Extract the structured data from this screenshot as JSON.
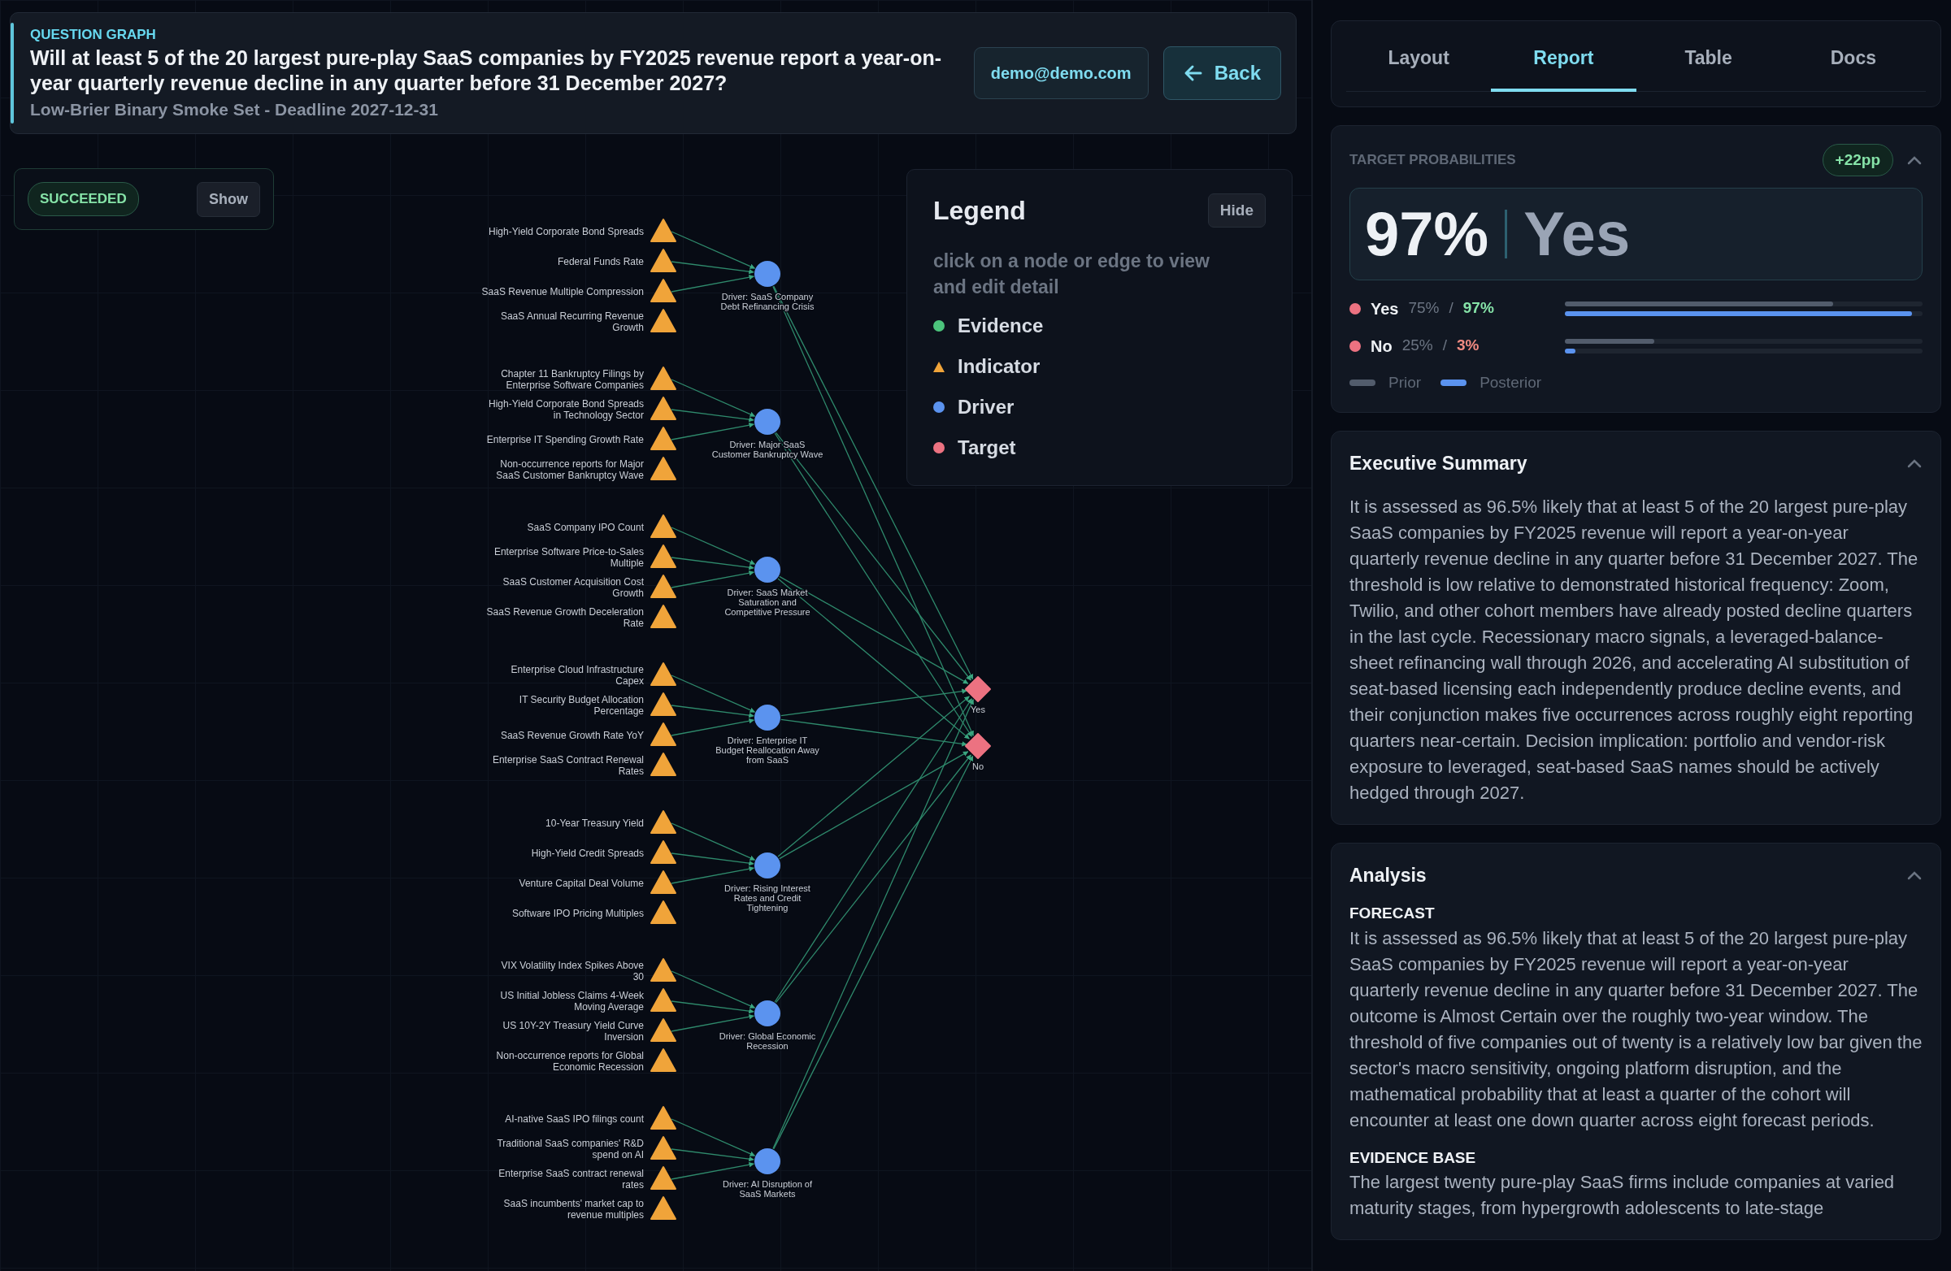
{
  "header": {
    "eyebrow": "QUESTION GRAPH",
    "question": "Will at least 5 of the 20 largest pure-play SaaS companies by FY2025 revenue report a year-on-year quarterly revenue decline in any quarter before 31 December 2027?",
    "subtitle": "Low-Brier Binary Smoke Set - Deadline 2027-12-31",
    "user": "demo@demo.com",
    "back": "Back"
  },
  "status": {
    "badge": "SUCCEEDED",
    "button": "Show"
  },
  "legend": {
    "title": "Legend",
    "button": "Hide",
    "hint": "click on a node or edge to view and edit detail",
    "items": [
      {
        "label": "Evidence",
        "kind": "dot",
        "color": "#4cc47c"
      },
      {
        "label": "Indicator",
        "kind": "triangle",
        "color": "#f0a43a"
      },
      {
        "label": "Driver",
        "kind": "dot",
        "color": "#5b93ef"
      },
      {
        "label": "Target",
        "kind": "dot",
        "color": "#ec7281"
      }
    ]
  },
  "graph": {
    "targets": [
      {
        "label": "Yes"
      },
      {
        "label": "No"
      }
    ],
    "drivers": [
      {
        "label": "Driver: SaaS Company Debt Refinancing Crisis",
        "indicators": [
          {
            "label": "High-Yield Corporate Bond Spreads",
            "linked": true
          },
          {
            "label": "Federal Funds Rate",
            "linked": true
          },
          {
            "label": "SaaS Revenue Multiple Compression",
            "linked": true
          },
          {
            "label": "SaaS Annual Recurring Revenue Growth",
            "linked": false
          }
        ]
      },
      {
        "label": "Driver: Major SaaS Customer Bankruptcy Wave",
        "indicators": [
          {
            "label": "Chapter 11 Bankruptcy Filings by Enterprise Software Companies",
            "linked": true
          },
          {
            "label": "High-Yield Corporate Bond Spreads in Technology Sector",
            "linked": true
          },
          {
            "label": "Enterprise IT Spending Growth Rate",
            "linked": true
          },
          {
            "label": "Non-occurrence reports for Major SaaS Customer Bankruptcy Wave",
            "linked": false
          }
        ]
      },
      {
        "label": "Driver: SaaS Market Saturation and Competitive Pressure",
        "indicators": [
          {
            "label": "SaaS Company IPO Count",
            "linked": true
          },
          {
            "label": "Enterprise Software Price-to-Sales Multiple",
            "linked": true
          },
          {
            "label": "SaaS Customer Acquisition Cost Growth",
            "linked": true
          },
          {
            "label": "SaaS Revenue Growth Deceleration Rate",
            "linked": false
          }
        ]
      },
      {
        "label": "Driver: Enterprise IT Budget Reallocation Away from SaaS",
        "indicators": [
          {
            "label": "Enterprise Cloud Infrastructure Capex",
            "linked": true
          },
          {
            "label": "IT Security Budget Allocation Percentage",
            "linked": true
          },
          {
            "label": "SaaS Revenue Growth Rate YoY",
            "linked": true
          },
          {
            "label": "Enterprise SaaS Contract Renewal Rates",
            "linked": false
          }
        ]
      },
      {
        "label": "Driver: Rising Interest Rates and Credit Tightening",
        "indicators": [
          {
            "label": "10-Year Treasury Yield",
            "linked": true
          },
          {
            "label": "High-Yield Credit Spreads",
            "linked": true
          },
          {
            "label": "Venture Capital Deal Volume",
            "linked": true
          },
          {
            "label": "Software IPO Pricing Multiples",
            "linked": false
          }
        ]
      },
      {
        "label": "Driver: Global Economic Recession",
        "indicators": [
          {
            "label": "VIX Volatility Index Spikes Above 30",
            "linked": true
          },
          {
            "label": "US Initial Jobless Claims 4-Week Moving Average",
            "linked": true
          },
          {
            "label": "US 10Y-2Y Treasury Yield Curve Inversion",
            "linked": true
          },
          {
            "label": "Non-occurrence reports for Global Economic Recession",
            "linked": false
          }
        ]
      },
      {
        "label": "Driver: AI Disruption of SaaS Markets",
        "indicators": [
          {
            "label": "AI-native SaaS IPO filings count",
            "linked": true
          },
          {
            "label": "Traditional SaaS companies' R&D spend on AI",
            "linked": true
          },
          {
            "label": "Enterprise SaaS contract renewal rates",
            "linked": true
          },
          {
            "label": "SaaS incumbents' market cap to revenue multiples",
            "linked": false
          }
        ]
      }
    ]
  },
  "tabs": [
    {
      "label": "Layout",
      "selected": false
    },
    {
      "label": "Report",
      "selected": true
    },
    {
      "label": "Table",
      "selected": false
    },
    {
      "label": "Docs",
      "selected": false
    }
  ],
  "probabilities": {
    "title": "TARGET PROBABILITIES",
    "delta": "+22pp",
    "expanded": true,
    "headline_value": "97%",
    "headline_label": "Yes",
    "outcomes": [
      {
        "label": "Yes",
        "separator": "/",
        "prior": {
          "text": "75%",
          "level": 0.75
        },
        "posterior": {
          "text": "97%",
          "level": 0.97,
          "color": "#86e3a8"
        }
      },
      {
        "label": "No",
        "separator": "/",
        "prior": {
          "text": "25%",
          "level": 0.25
        },
        "posterior": {
          "text": "3%",
          "level": 0.03,
          "color": "#f28b82"
        }
      }
    ],
    "legend": [
      "Prior",
      "Posterior"
    ]
  },
  "summary": {
    "title": "Executive Summary",
    "expanded": true,
    "text": "It is assessed as 96.5% likely that at least 5 of the 20 largest pure-play SaaS companies by FY2025 revenue will report a year-on-year quarterly revenue decline in any quarter before 31 December 2027. The threshold is low relative to demonstrated historical frequency: Zoom, Twilio, and other cohort members have already posted decline quarters in the last cycle. Recessionary macro signals, a leveraged-balance-sheet refinancing wall through 2026, and accelerating AI substitution of seat-based licensing each independently produce decline events, and their conjunction makes five occurrences across roughly eight reporting quarters near-certain. Decision implication: portfolio and vendor-risk exposure to leveraged, seat-based SaaS names should be actively hedged through 2027."
  },
  "analysis": {
    "title": "Analysis",
    "expanded": true,
    "sections": [
      {
        "heading": "FORECAST",
        "text": "It is assessed as 96.5% likely that at least 5 of the 20 largest pure-play SaaS companies by FY2025 revenue will report a year-on-year quarterly revenue decline in any quarter before 31 December 2027. The outcome is Almost Certain over the roughly two-year window. The threshold of five companies out of twenty is a relatively low bar given the sector's macro sensitivity, ongoing platform disruption, and the mathematical probability that at least a quarter of the cohort will encounter at least one down quarter across eight forecast periods."
      },
      {
        "heading": "EVIDENCE BASE",
        "text": "The largest twenty pure-play SaaS firms include companies at varied maturity stages, from hypergrowth adolescents to late-stage"
      }
    ]
  }
}
